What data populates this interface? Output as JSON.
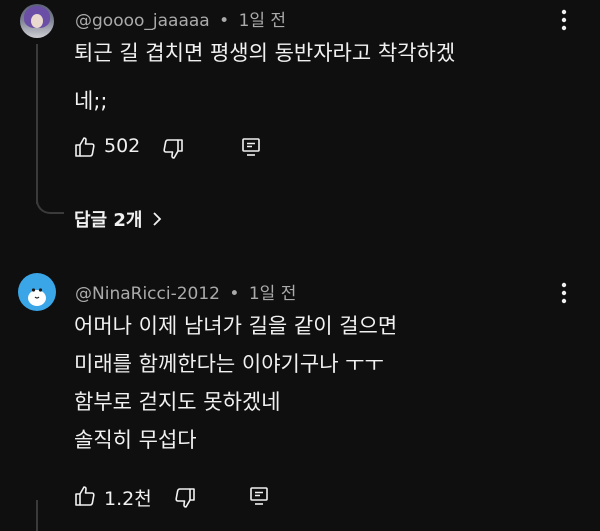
{
  "comments": [
    {
      "author": "@goooo_jaaaaa",
      "time": "1일 전",
      "lines": [
        "퇴근 길 겹치면 평생의 동반자라고 착각하겠",
        "네;;"
      ],
      "likes": "502",
      "replies_label": "답글 2개"
    },
    {
      "author": "@NinaRicci-2012",
      "time": "1일 전",
      "lines": [
        "어머나 이제 남녀가 길을 같이 걸으면",
        "미래를 함께한다는 이야기구나 ㅜㅜ",
        "함부로 걷지도 못하겠네",
        "솔직히 무섭다"
      ],
      "likes": "1.2천"
    }
  ],
  "separator": "•"
}
